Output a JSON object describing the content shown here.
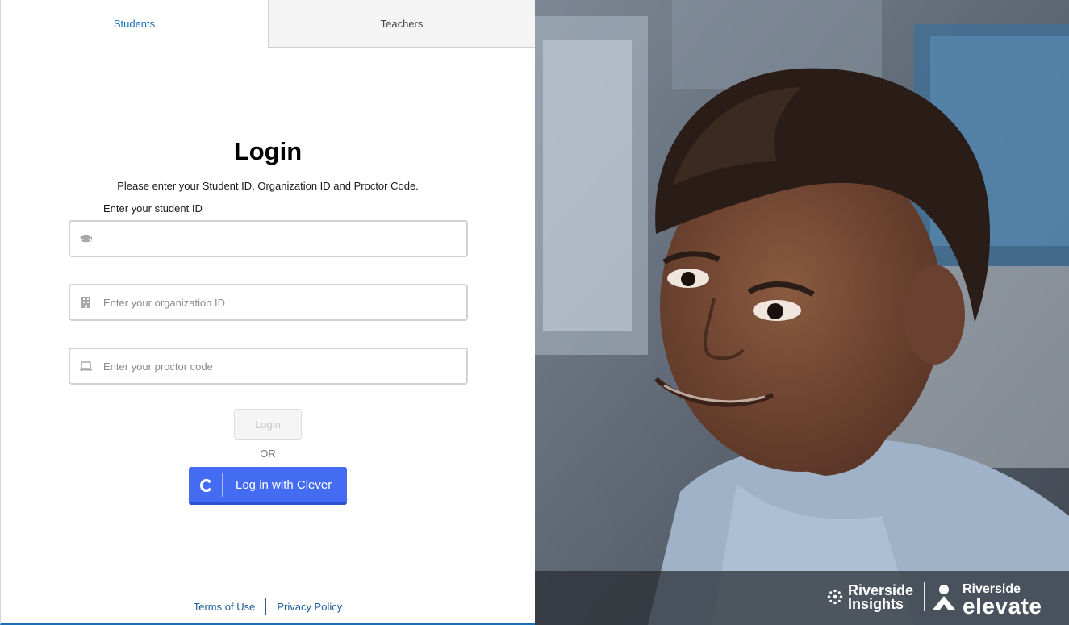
{
  "tabs": {
    "students": "Students",
    "teachers": "Teachers"
  },
  "login": {
    "title": "Login",
    "instructions": "Please enter your Student ID, Organization ID and Proctor Code.",
    "student_id_label": "Enter your student ID",
    "student_id_value": "",
    "organization_placeholder": "Enter your organization ID",
    "proctor_placeholder": "Enter your proctor code",
    "login_button": "Login",
    "or_text": "OR",
    "clever_button": "Log in with Clever"
  },
  "footer": {
    "terms": "Terms of Use",
    "privacy": "Privacy Policy"
  },
  "branding": {
    "riverside_insights": "Riverside Insights",
    "riverside_insights_line1": "Riverside",
    "riverside_insights_line2": "Insights",
    "elevate_top": "Riverside",
    "elevate_big": "elevate"
  },
  "icons": {
    "student_field": "graduation-cap-icon",
    "organization_field": "building-icon",
    "proctor_field": "laptop-icon",
    "clever": "clever-c-icon"
  },
  "colors": {
    "accent_tab": "#1b6fb5",
    "clever_blue": "#436cf2",
    "footer_link": "#1b5e9a"
  }
}
